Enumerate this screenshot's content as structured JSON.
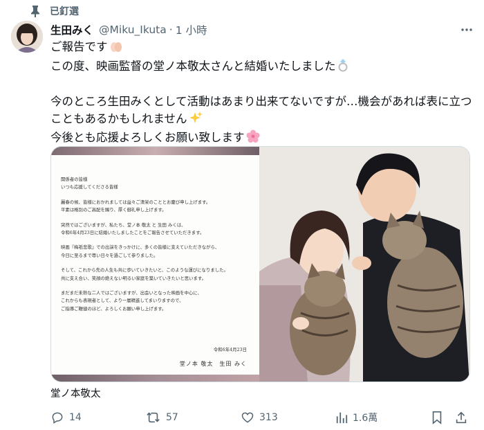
{
  "pinned": {
    "label": "已釘選",
    "icon": "pin-icon"
  },
  "author": {
    "name": "生田みく",
    "handle": "@Miku_Ikuta",
    "separator": "·",
    "time": "1 小時",
    "avatar_icon": "avatar"
  },
  "tweet": {
    "lines": [
      "ご報告です",
      "この度、映画監督の堂ノ本敬太さんと結婚いたしました",
      "今のところ生田みくとして活動はあまり出来てないですが…機会があれば表に立つ",
      "こともあるかもしれません",
      "今後とも応援よろしくお願い致します"
    ],
    "emojis": [
      "hands-emoji",
      "ring-emoji",
      "sparkles-emoji",
      "cherry-blossom-emoji"
    ]
  },
  "media": {
    "letter": {
      "lines": [
        "関係者の皆様",
        "いつも応援してくださる皆様",
        "",
        "麗春の候、皆様におかれましては益々ご清栄のこととお慶び申し上げます。",
        "平素は格別のご高配を賜り、厚く御礼申し上げます。",
        "",
        "突然ではございますが、私たち、堂ノ本 敬太 と 生田 みくは、",
        "令和6年4月23日に結婚いたしましたことをご報告させていただきます。",
        "",
        "映画『梅祇悲歌』での出演をきっかけに、多くの皆様に支えていただきながら、",
        "今日に至るまで尊い日々を過ごして参りました。",
        "",
        "そして、これから先の人生も共に歩いていきたいと、このような運びになりました。",
        "共に支え合い、笑顔の絶えない明るい家庭を築いていきたいと思います。",
        "",
        "まだまだ未熟な二人ではございますが、出会いとなった映画を中心に、",
        "これからも表現者として、より一層精進してまいりますので、",
        "ご指導ご鞭撻のほど、よろしくお願い申し上げます。"
      ],
      "date": "令和6年4月23日",
      "signature": "堂ノ本 敬太　生田 みく"
    },
    "photo_icon": "couple-with-cats-photo"
  },
  "alt_caption": "堂ノ本敬太",
  "actions": {
    "replies": "14",
    "retweets": "57",
    "likes": "313",
    "views": "1.6萬"
  },
  "colors": {
    "text": "#0f1419",
    "secondary": "#536471",
    "border": "#cfd9de"
  }
}
